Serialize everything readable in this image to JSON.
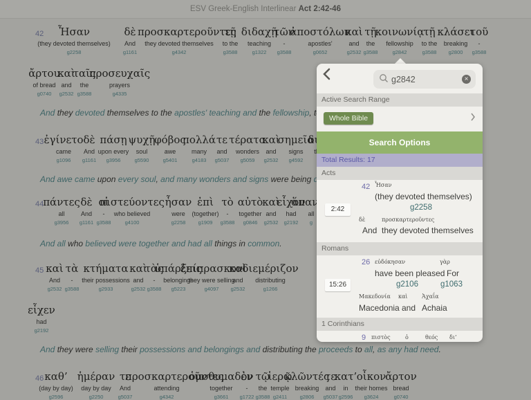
{
  "titlebar": {
    "app": "ESV Greek-English Interlinear",
    "reference": "Act 2:42-46"
  },
  "verses": [
    {
      "num": "42",
      "lines": [
        [
          {
            "gk": "Ἦσαν",
            "en": "(they devoted themselves)",
            "sn": "g2258"
          },
          {
            "gk": "δὲ",
            "en": "And",
            "sn": "g1161"
          },
          {
            "gk": "προσκαρτεροῦντες",
            "en": "they devoted themselves",
            "sn": "g4342"
          },
          {
            "gk": "τῇ",
            "en": "to the",
            "sn": "g3588"
          },
          {
            "gk": "διδαχῇ",
            "en": "teaching",
            "sn": "g1322"
          },
          {
            "gk": "τῶν",
            "en": "-",
            "sn": "g3588"
          },
          {
            "gk": "ἀποστόλων",
            "en": "apostles'",
            "sn": "g0652"
          },
          {
            "gk": "καὶ",
            "en": "and",
            "sn": "g2532"
          },
          {
            "gk": "τῇ",
            "en": "the",
            "sn": "g3588"
          },
          {
            "gk": "κοινωνίᾳ",
            "en": "fellowship",
            "sn": "g2842"
          },
          {
            "gk": "τῇ",
            "en": "to the",
            "sn": "g3588"
          },
          {
            "gk": "κλάσει",
            "en": "breaking",
            "sn": "g2800"
          },
          {
            "gk": "τοῦ",
            "en": "-",
            "sn": "g3588"
          }
        ],
        [
          {
            "gk": "ἄρτου",
            "en": "of bread",
            "sn": "g0740"
          },
          {
            "gk": "καὶ",
            "en": "and",
            "sn": "g2532"
          },
          {
            "gk": "ταῖς",
            "en": "the",
            "sn": "g3588"
          },
          {
            "gk": "προσευχαῖς",
            "en": "prayers",
            "sn": "g4335"
          }
        ]
      ],
      "translation": [
        {
          "t": "And",
          "hl": true
        },
        {
          "t": " they ",
          "hl": false
        },
        {
          "t": "devoted",
          "hl": true
        },
        {
          "t": " themselves to the ",
          "hl": false
        },
        {
          "t": "apostles' teaching",
          "hl": true
        },
        {
          "t": " ",
          "hl": false
        },
        {
          "t": "and",
          "hl": true
        },
        {
          "t": " the ",
          "hl": false
        },
        {
          "t": "fellowship",
          "hl": true
        },
        {
          "t": ", to the",
          "hl": false
        }
      ]
    },
    {
      "num": "43",
      "lines": [
        [
          {
            "gk": "ἐγίνετο",
            "en": "came",
            "sn": "g1096"
          },
          {
            "gk": "δὲ",
            "en": "And",
            "sn": "g1161"
          },
          {
            "gk": "πάσῃ",
            "en": "upon every",
            "sn": "g3956"
          },
          {
            "gk": "ψυχῇ",
            "en": "soul",
            "sn": "g5590"
          },
          {
            "gk": "φόβος",
            "en": "awe",
            "sn": "g5401"
          },
          {
            "gk": "πολλά",
            "en": "many",
            "sn": "g4183"
          },
          {
            "gk": "τε",
            "en": "and",
            "sn": "g5037"
          },
          {
            "gk": "τέρατα",
            "en": "wonders",
            "sn": "g5059"
          },
          {
            "gk": "καὶ",
            "en": "and",
            "sn": "g2532"
          },
          {
            "gk": "σημεῖα",
            "en": "signs",
            "sn": "g4592"
          },
          {
            "gk": "διὰ",
            "en": "th",
            "sn": ""
          }
        ]
      ],
      "translation": [
        {
          "t": "And awe came",
          "hl": true
        },
        {
          "t": " upon ",
          "hl": false
        },
        {
          "t": "every soul",
          "hl": true
        },
        {
          "t": ", ",
          "hl": false
        },
        {
          "t": "and many wonders and signs",
          "hl": true
        },
        {
          "t": " were being ",
          "hl": false
        },
        {
          "t": "done",
          "hl": true
        }
      ]
    },
    {
      "num": "44",
      "lines": [
        [
          {
            "gk": "πάντες",
            "en": "all",
            "sn": "g3956"
          },
          {
            "gk": "δὲ",
            "en": "And",
            "sn": "g1161"
          },
          {
            "gk": "οἱ",
            "en": "-",
            "sn": "g3588"
          },
          {
            "gk": "πιστεύοντες",
            "en": "who believed",
            "sn": "g4100"
          },
          {
            "gk": "ἦσαν",
            "en": "were",
            "sn": "g2258"
          },
          {
            "gk": "ἐπὶ",
            "en": "(together)",
            "sn": "g1909"
          },
          {
            "gk": "τὸ",
            "en": "-",
            "sn": "g3588"
          },
          {
            "gk": "αὐτὸ",
            "en": "together",
            "sn": "g0846"
          },
          {
            "gk": "καὶ",
            "en": "and",
            "sn": "g2532"
          },
          {
            "gk": "εἶχον",
            "en": "had",
            "sn": "g2192"
          },
          {
            "gk": "ἅπαντα",
            "en": "all",
            "sn": "g"
          }
        ]
      ],
      "translation": [
        {
          "t": "And all",
          "hl": true
        },
        {
          "t": " who ",
          "hl": false
        },
        {
          "t": "believed were together and had all",
          "hl": true
        },
        {
          "t": " things in ",
          "hl": false
        },
        {
          "t": "common",
          "hl": true
        },
        {
          "t": ".",
          "hl": false
        }
      ]
    },
    {
      "num": "45",
      "lines": [
        [
          {
            "gk": "καὶ",
            "en": "And",
            "sn": "g2532"
          },
          {
            "gk": "τὰ",
            "en": "-",
            "sn": "g3588"
          },
          {
            "gk": "κτήματα",
            "en": "their possessions",
            "sn": "g2933"
          },
          {
            "gk": "καὶ",
            "en": "and",
            "sn": "g2532"
          },
          {
            "gk": "τὰς",
            "en": "-",
            "sn": "g3588"
          },
          {
            "gk": "ὑπάρξεις",
            "en": "belongings",
            "sn": "g5223"
          },
          {
            "gk": "ἐπίπρασκον",
            "en": "they were selling",
            "sn": "g4097"
          },
          {
            "gk": "καὶ",
            "en": "and",
            "sn": "g2532"
          },
          {
            "gk": "διεμέριζον",
            "en": "distributing",
            "sn": "g1266"
          }
        ],
        [
          {
            "gk": "εἶχεν",
            "en": "had",
            "sn": "g2192"
          }
        ]
      ],
      "translation": [
        {
          "t": "And",
          "hl": true
        },
        {
          "t": " they were ",
          "hl": false
        },
        {
          "t": "selling",
          "hl": true
        },
        {
          "t": " their ",
          "hl": false
        },
        {
          "t": "possessions and belongings and",
          "hl": true
        },
        {
          "t": " distributing the ",
          "hl": false
        },
        {
          "t": "proceeds",
          "hl": true
        },
        {
          "t": " to ",
          "hl": false
        },
        {
          "t": "all",
          "hl": true
        },
        {
          "t": ", ",
          "hl": false
        },
        {
          "t": "as any had need",
          "hl": true
        },
        {
          "t": ".",
          "hl": false
        }
      ]
    },
    {
      "num": "46",
      "lines": [
        [
          {
            "gk": "καθ’",
            "en": "(day by day)",
            "sn": "g2596"
          },
          {
            "gk": "ἡμέραν",
            "en": "day by day",
            "sn": "g2250"
          },
          {
            "gk": "τε",
            "en": "And",
            "sn": "g5037"
          },
          {
            "gk": "προσκαρτεροῦντες",
            "en": "attending",
            "sn": "g4342"
          },
          {
            "gk": "ὁμοθυμαδὸν",
            "en": "together",
            "sn": "g3661"
          },
          {
            "gk": "ἐν",
            "en": "-",
            "sn": "g1722"
          },
          {
            "gk": "τῷ",
            "en": "the",
            "sn": "g3588"
          },
          {
            "gk": "ἱερῷ",
            "en": "temple",
            "sn": "g2411"
          },
          {
            "gk": "κλῶντές",
            "en": "breaking",
            "sn": "g2806"
          },
          {
            "gk": "τε",
            "en": "and",
            "sn": "g5037"
          },
          {
            "gk": "κατ’",
            "en": "in",
            "sn": "g2596"
          },
          {
            "gk": "οἶκον",
            "en": "their homes",
            "sn": "g3624"
          },
          {
            "gk": "ἄρτον",
            "en": "bread",
            "sn": "g0740"
          }
        ]
      ],
      "translation": []
    }
  ],
  "popover": {
    "back_label": "‹",
    "search": {
      "value": "g2842",
      "placeholder": "Search"
    },
    "active_range_header": "Active Search Range",
    "range_button": "Whole Bible",
    "search_options": "Search Options",
    "total_results": "Total Results: 17",
    "colors": {
      "search_options_bg": "#93b36c",
      "range_btn_bg": "#6f8b4f",
      "total_bg": "#b1aecb",
      "total_text": "#5a58a6"
    },
    "groups": [
      {
        "book": "Acts",
        "results": [
          {
            "ref": "2:42",
            "num": "42",
            "row1_gk": [
              "Ἦσαν"
            ],
            "row1_en": [
              "(they devoted themselves)"
            ],
            "row1_sn": [
              "g2258"
            ],
            "row2_gk": [
              "δὲ",
              "προσκαρτεροῦντες"
            ],
            "row2_en": [
              "And",
              "they devoted themselves"
            ]
          }
        ]
      },
      {
        "book": "Romans",
        "results": [
          {
            "ref": "15:26",
            "num": "26",
            "row1_gk": [
              "εὐδόκησαν",
              "γὰρ"
            ],
            "row1_en": [
              "have been pleased",
              "For"
            ],
            "row1_sn": [
              "g2106",
              "g1063"
            ],
            "row2_gk": [
              "Μακεδονία",
              "καὶ",
              "Ἀχαΐα"
            ],
            "row2_en": [
              "Macedonia",
              "and",
              "Achaia"
            ]
          }
        ]
      },
      {
        "book": "1 Corinthians",
        "results": [
          {
            "num": "9",
            "row1_gk": [
              "πιστὸς",
              "ὁ",
              "θεός",
              "δι’"
            ]
          }
        ]
      }
    ]
  }
}
